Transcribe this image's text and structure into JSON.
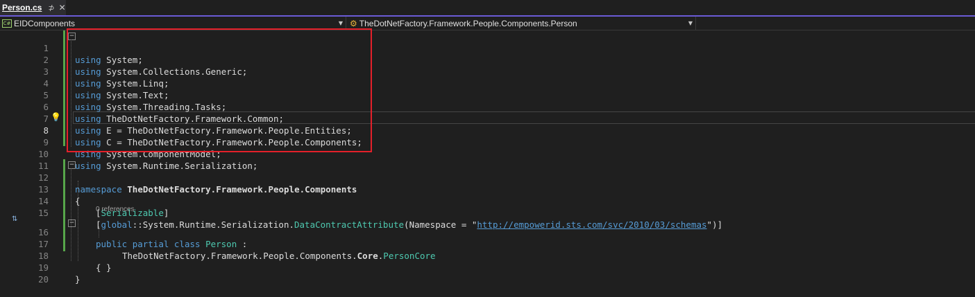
{
  "tab": {
    "title": "Person.cs",
    "pin": "⊅",
    "close": "✕"
  },
  "navbar": {
    "project": "EIDComponents",
    "type": "TheDotNetFactory.Framework.People.Components.Person"
  },
  "editor": {
    "current_line": "8",
    "references_label": "0 references",
    "line_numbers": [
      "1",
      "2",
      "3",
      "4",
      "5",
      "6",
      "7",
      "8",
      "9",
      "10",
      "11",
      "12",
      "13",
      "14",
      "15",
      "16",
      "17",
      "18",
      "19",
      "20"
    ],
    "lines": {
      "l1": [
        "using",
        "System;"
      ],
      "l2": [
        "using",
        "System.Collections.Generic;"
      ],
      "l3": [
        "using",
        "System.Linq;"
      ],
      "l4": [
        "using",
        "System.Text;"
      ],
      "l5": [
        "using",
        "System.Threading.Tasks;"
      ],
      "l6": [
        "using",
        "TheDotNetFactory.Framework.Common;"
      ],
      "l7": [
        "using",
        "E = TheDotNetFactory.Framework.People.Entities;"
      ],
      "l8": [
        "using",
        "C = TheDotNetFactory.Framework.People.Components;"
      ],
      "l9": [
        "using",
        "System.ComponentModel;"
      ],
      "l10": [
        "using",
        "System.Runtime.Serialization;"
      ],
      "l12": [
        "namespace",
        "TheDotNetFactory.Framework.People.Components"
      ],
      "l13": "{",
      "l14": {
        "open": "[",
        "attr": "Serializable",
        "close": "]"
      },
      "l15": {
        "open": "[",
        "global": "global",
        "sep": "::",
        "path": "System.Runtime.Serialization.",
        "attr": "DataContractAttribute",
        "args_start": "(Namespace = \"",
        "url": "http://empowerid.sts.com/svc/2010/03/schemas",
        "args_end": "\")]"
      },
      "l16": {
        "kw1": "public",
        "kw2": "partial",
        "kw3": "class",
        "name": "Person",
        "colon": " :"
      },
      "l17": {
        "path": "TheDotNetFactory.Framework.People.Components.",
        "core": "Core",
        "dot": ".",
        "type": "PersonCore"
      },
      "l18": "{ }",
      "l19": "}"
    }
  },
  "colors": {
    "keyword": "#569cd6",
    "type": "#4ec9b0",
    "string": "#d69d85",
    "highlight_box": "#e5202a",
    "change_bar": "#57a64a"
  }
}
